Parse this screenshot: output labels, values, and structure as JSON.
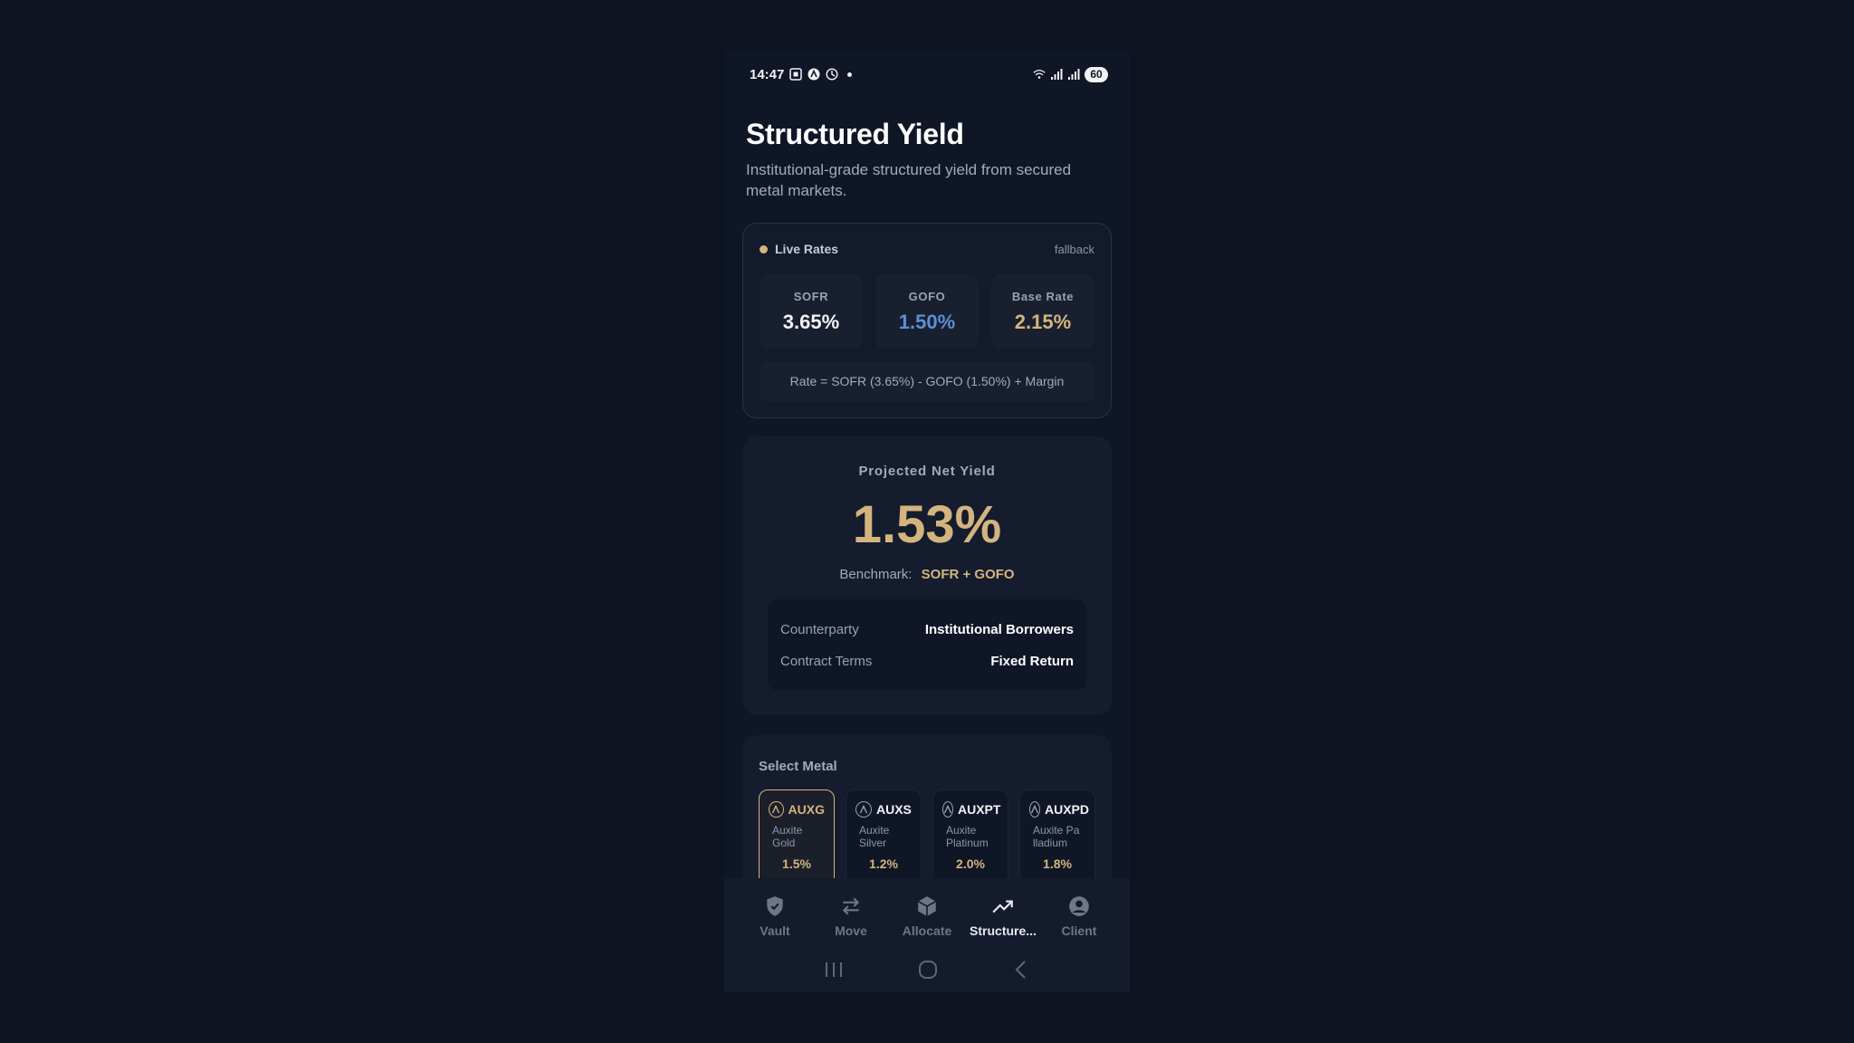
{
  "status_bar": {
    "time": "14:47",
    "battery": "60"
  },
  "header": {
    "title": "Structured Yield",
    "subtitle": "Institutional-grade structured yield from secured metal markets."
  },
  "live_rates": {
    "title": "Live Rates",
    "source": "fallback",
    "tiles": [
      {
        "label": "SOFR",
        "value": "3.65%",
        "color": "#f2f3f6"
      },
      {
        "label": "GOFO",
        "value": "1.50%",
        "color": "#5b8fd8"
      },
      {
        "label": "Base Rate",
        "value": "2.15%",
        "color": "#d4b47e"
      }
    ],
    "formula": "Rate = SOFR (3.65%) - GOFO (1.50%) + Margin"
  },
  "projection": {
    "label": "Projected Net Yield",
    "value": "1.53%",
    "benchmark_label": "Benchmark:",
    "benchmark_value": "SOFR + GOFO",
    "terms": [
      {
        "key": "Counterparty",
        "value": "Institutional Borrowers"
      },
      {
        "key": "Contract Terms",
        "value": "Fixed Return"
      }
    ]
  },
  "metals": {
    "title": "Select Metal",
    "items": [
      {
        "symbol": "AUXG",
        "name": "Auxite Gold",
        "rate": "1.5%",
        "selected": true
      },
      {
        "symbol": "AUXS",
        "name": "Auxite Silver",
        "rate": "1.2%",
        "selected": false
      },
      {
        "symbol": "AUXPT",
        "name": "Auxite Platinum",
        "rate": "2.0%",
        "selected": false
      },
      {
        "symbol": "AUXPD",
        "name": "Auxite Pa lladium",
        "rate": "1.8%",
        "selected": false
      }
    ]
  },
  "nav": {
    "items": [
      {
        "label": "Vault",
        "icon": "shield-icon"
      },
      {
        "label": "Move",
        "icon": "swap-arrows-icon"
      },
      {
        "label": "Allocate",
        "icon": "cube-icon"
      },
      {
        "label": "Structure...",
        "icon": "trending-up-icon",
        "active": true
      },
      {
        "label": "Client",
        "icon": "user-circle-icon"
      }
    ]
  },
  "colors": {
    "accent": "#d4b47e",
    "background": "#0d1320",
    "card": "#141c2e"
  }
}
